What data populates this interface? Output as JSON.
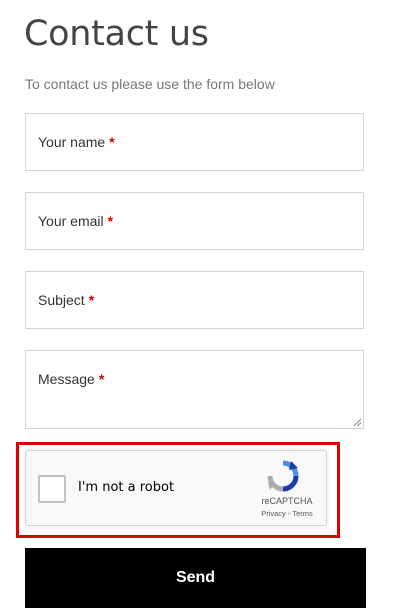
{
  "title": "Contact us",
  "intro": "To contact us please use the form below",
  "fields": {
    "name": {
      "label": "Your name",
      "required_mark": "*"
    },
    "email": {
      "label": "Your email",
      "required_mark": "*"
    },
    "subject": {
      "label": "Subject",
      "required_mark": "*"
    },
    "message": {
      "label": "Message",
      "required_mark": "*"
    }
  },
  "recaptcha": {
    "label": "I'm not a robot",
    "brand": "reCAPTCHA",
    "privacy": "Privacy",
    "separator": " - ",
    "terms": "Terms",
    "highlight_color": "#e00000"
  },
  "send_label": "Send",
  "colors": {
    "required": "#d60000",
    "button_bg": "#000000",
    "button_text": "#ffffff"
  }
}
